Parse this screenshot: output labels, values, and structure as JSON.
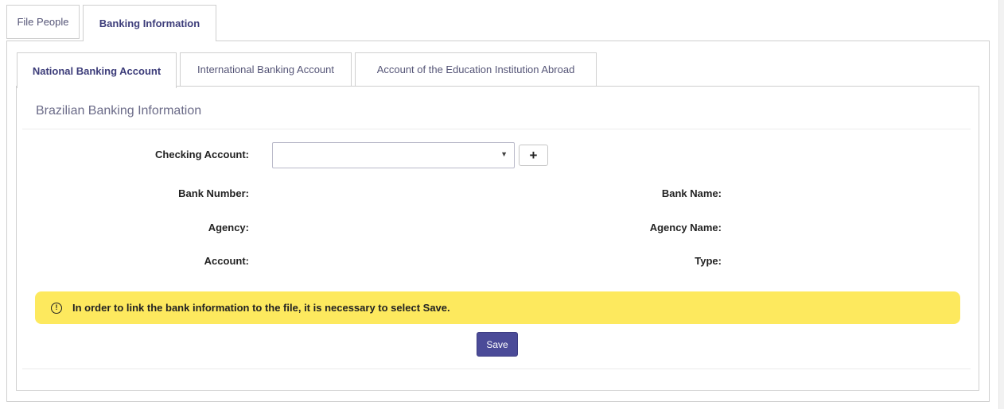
{
  "tabs": {
    "file_people": "File People",
    "banking_information": "Banking Information"
  },
  "inner_tabs": {
    "national": "National Banking Account",
    "international": "International Banking Account",
    "education": "Account of the Education Institution Abroad"
  },
  "section": {
    "title": "Brazilian Banking Information"
  },
  "form": {
    "checking_account_label": "Checking Account:",
    "checking_account_value": "",
    "add_symbol": "+",
    "bank_number_label": "Bank Number:",
    "bank_name_label": "Bank Name:",
    "agency_label": "Agency:",
    "agency_name_label": "Agency Name:",
    "account_label": "Account:",
    "type_label": "Type:"
  },
  "alert": {
    "message": "In order to link the bank information to the file, it is necessary to select Save."
  },
  "actions": {
    "save_label": "Save"
  },
  "colors": {
    "accent": "#4b4b98",
    "alert_bg": "#fde95e",
    "tab_active_text": "#3d3d7a"
  }
}
